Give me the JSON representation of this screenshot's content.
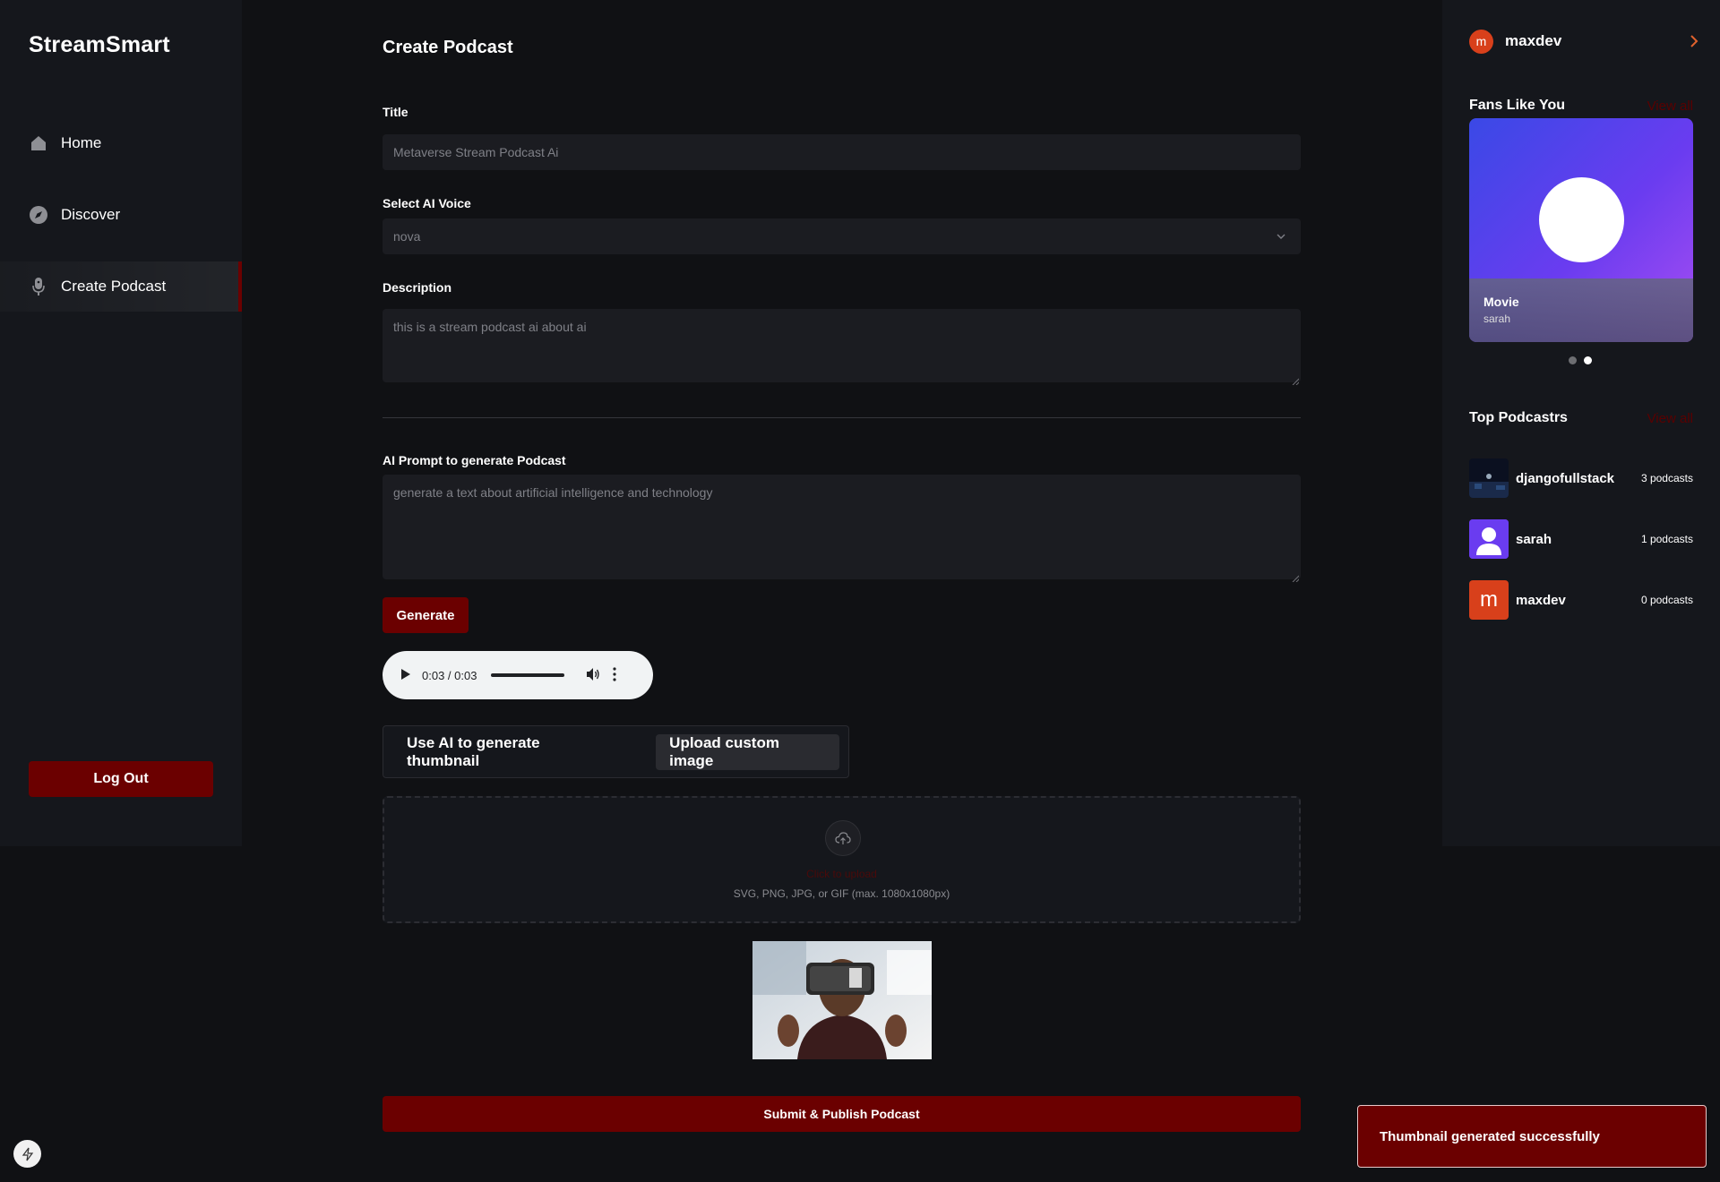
{
  "app": {
    "brand": "StreamSmart"
  },
  "nav": {
    "items": [
      {
        "label": "Home",
        "icon": "home-icon"
      },
      {
        "label": "Discover",
        "icon": "compass-icon"
      },
      {
        "label": "Create Podcast",
        "icon": "microphone-icon",
        "active": true
      }
    ],
    "logout_label": "Log Out"
  },
  "form": {
    "page_title": "Create Podcast",
    "title_label": "Title",
    "title_value": "Metaverse Stream Podcast Ai",
    "voice_label": "Select AI Voice",
    "voice_value": "nova",
    "description_label": "Description",
    "description_value": "this is a stream podcast ai about ai",
    "prompt_label": "AI Prompt to generate Podcast",
    "prompt_value": "generate a text about artificial intelligence and technology",
    "generate_label": "Generate",
    "audio": {
      "time": "0:03 / 0:03"
    },
    "thumbnail": {
      "ai_label": "Use AI to generate thumbnail",
      "upload_label": "Upload custom image",
      "click_to_upload": "Click to upload",
      "hint": "SVG, PNG, JPG, or GIF (max. 1080x1080px)"
    },
    "submit_label": "Submit & Publish Podcast"
  },
  "user": {
    "name": "maxdev",
    "initial": "m"
  },
  "fans": {
    "title": "Fans Like You",
    "view_all": "View all",
    "card": {
      "title": "Movie",
      "author": "sarah"
    },
    "carousel": {
      "count": 2,
      "active_index": 1
    }
  },
  "top_podcasters": {
    "title": "Top Podcastrs",
    "view_all": "View all",
    "items": [
      {
        "name": "djangofullstack",
        "count": "3 podcasts"
      },
      {
        "name": "sarah",
        "count": "1 podcasts"
      },
      {
        "name": "maxdev",
        "count": "0 podcasts",
        "initial": "m"
      }
    ]
  },
  "toast": {
    "message": "Thumbnail generated successfully"
  },
  "colors": {
    "accent": "#6b0000",
    "background": "#101114",
    "panel": "#15171c",
    "field": "#1b1c21"
  }
}
